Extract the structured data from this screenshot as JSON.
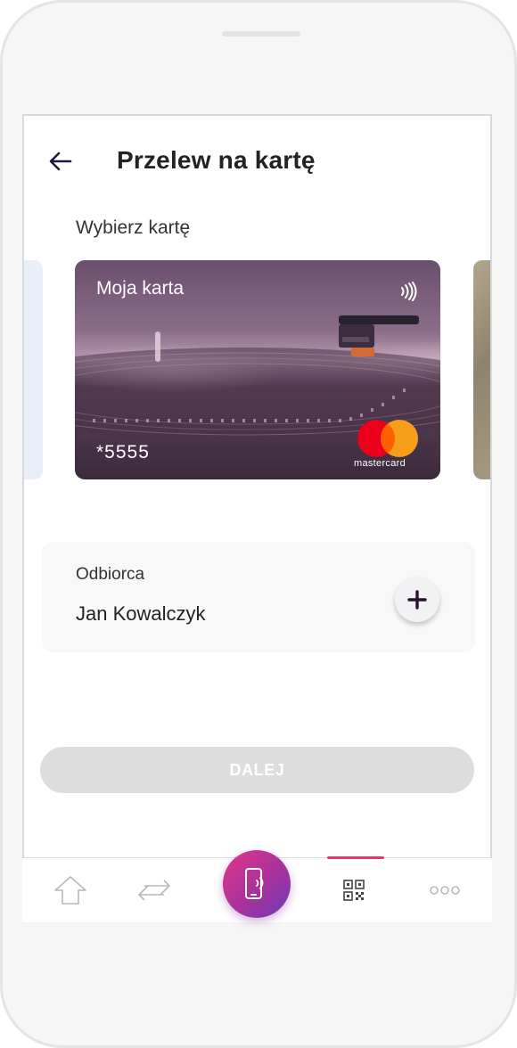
{
  "header": {
    "title": "Przelew na kartę"
  },
  "card_section": {
    "label": "Wybierz kartę",
    "card": {
      "name": "Moja karta",
      "number": "*5555",
      "network": "mastercard"
    }
  },
  "recipient": {
    "label": "Odbiorca",
    "name": "Jan Kowalczyk"
  },
  "actions": {
    "next_label": "DALEJ"
  },
  "bottom_nav": {
    "items": [
      "home-icon",
      "transfer-icon",
      "contactless-payment-icon",
      "qr-code-icon",
      "more-icon"
    ],
    "active_index": 3
  },
  "colors": {
    "accent": "#e8365a",
    "pay_gradient_start": "#e2368a",
    "pay_gradient_end": "#6c3ab8",
    "disabled_button": "#dddddd"
  }
}
